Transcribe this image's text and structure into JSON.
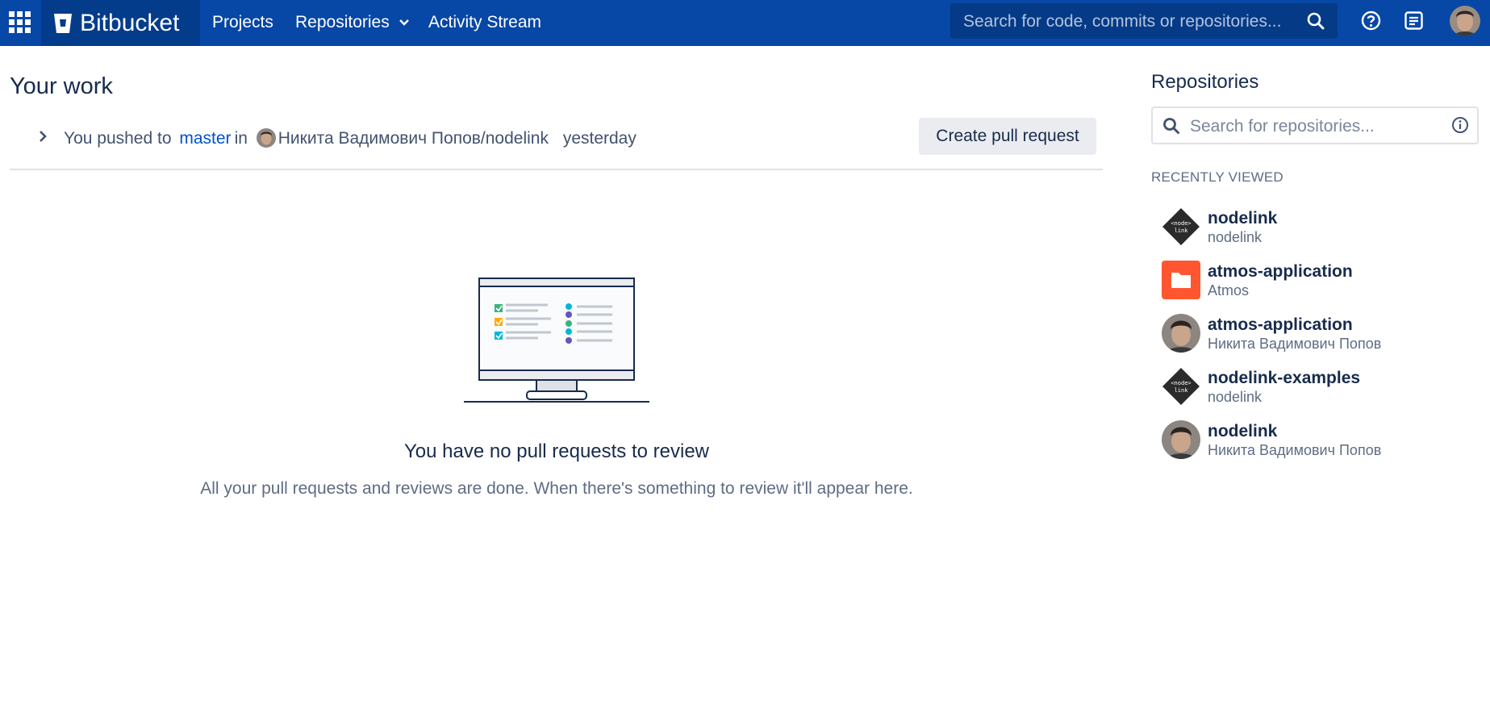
{
  "header": {
    "brand": "Bitbucket",
    "nav": {
      "projects": "Projects",
      "repositories": "Repositories",
      "activity": "Activity Stream"
    },
    "search_placeholder": "Search for code, commits or repositories..."
  },
  "main": {
    "title": "Your work",
    "activity": {
      "prefix": "You pushed to",
      "branch": "master",
      "connector": "in",
      "repository": "Никита Вадимович Попов/nodelink",
      "time": "yesterday",
      "button": "Create pull request"
    },
    "empty": {
      "title": "You have no pull requests to review",
      "description": "All your pull requests and reviews are done. When there's something to review it'll appear here."
    }
  },
  "sidebar": {
    "title": "Repositories",
    "search_placeholder": "Search for repositories...",
    "recent_heading": "RECENTLY VIEWED",
    "recent": [
      {
        "name": "nodelink",
        "project": "nodelink",
        "icon": "nodelink-logo-icon"
      },
      {
        "name": "atmos-application",
        "project": "Atmos",
        "icon": "folder-icon"
      },
      {
        "name": "atmos-application",
        "project": "Никита Вадимович Попов",
        "icon": "user-avatar"
      },
      {
        "name": "nodelink-examples",
        "project": "nodelink",
        "icon": "nodelink-logo-icon"
      },
      {
        "name": "nodelink",
        "project": "Никита Вадимович Попов",
        "icon": "user-avatar"
      }
    ]
  },
  "colors": {
    "header": "#0747a6",
    "brand_bg": "#043c8c",
    "link": "#0052cc",
    "atmos_avatar": "#ff5630"
  }
}
